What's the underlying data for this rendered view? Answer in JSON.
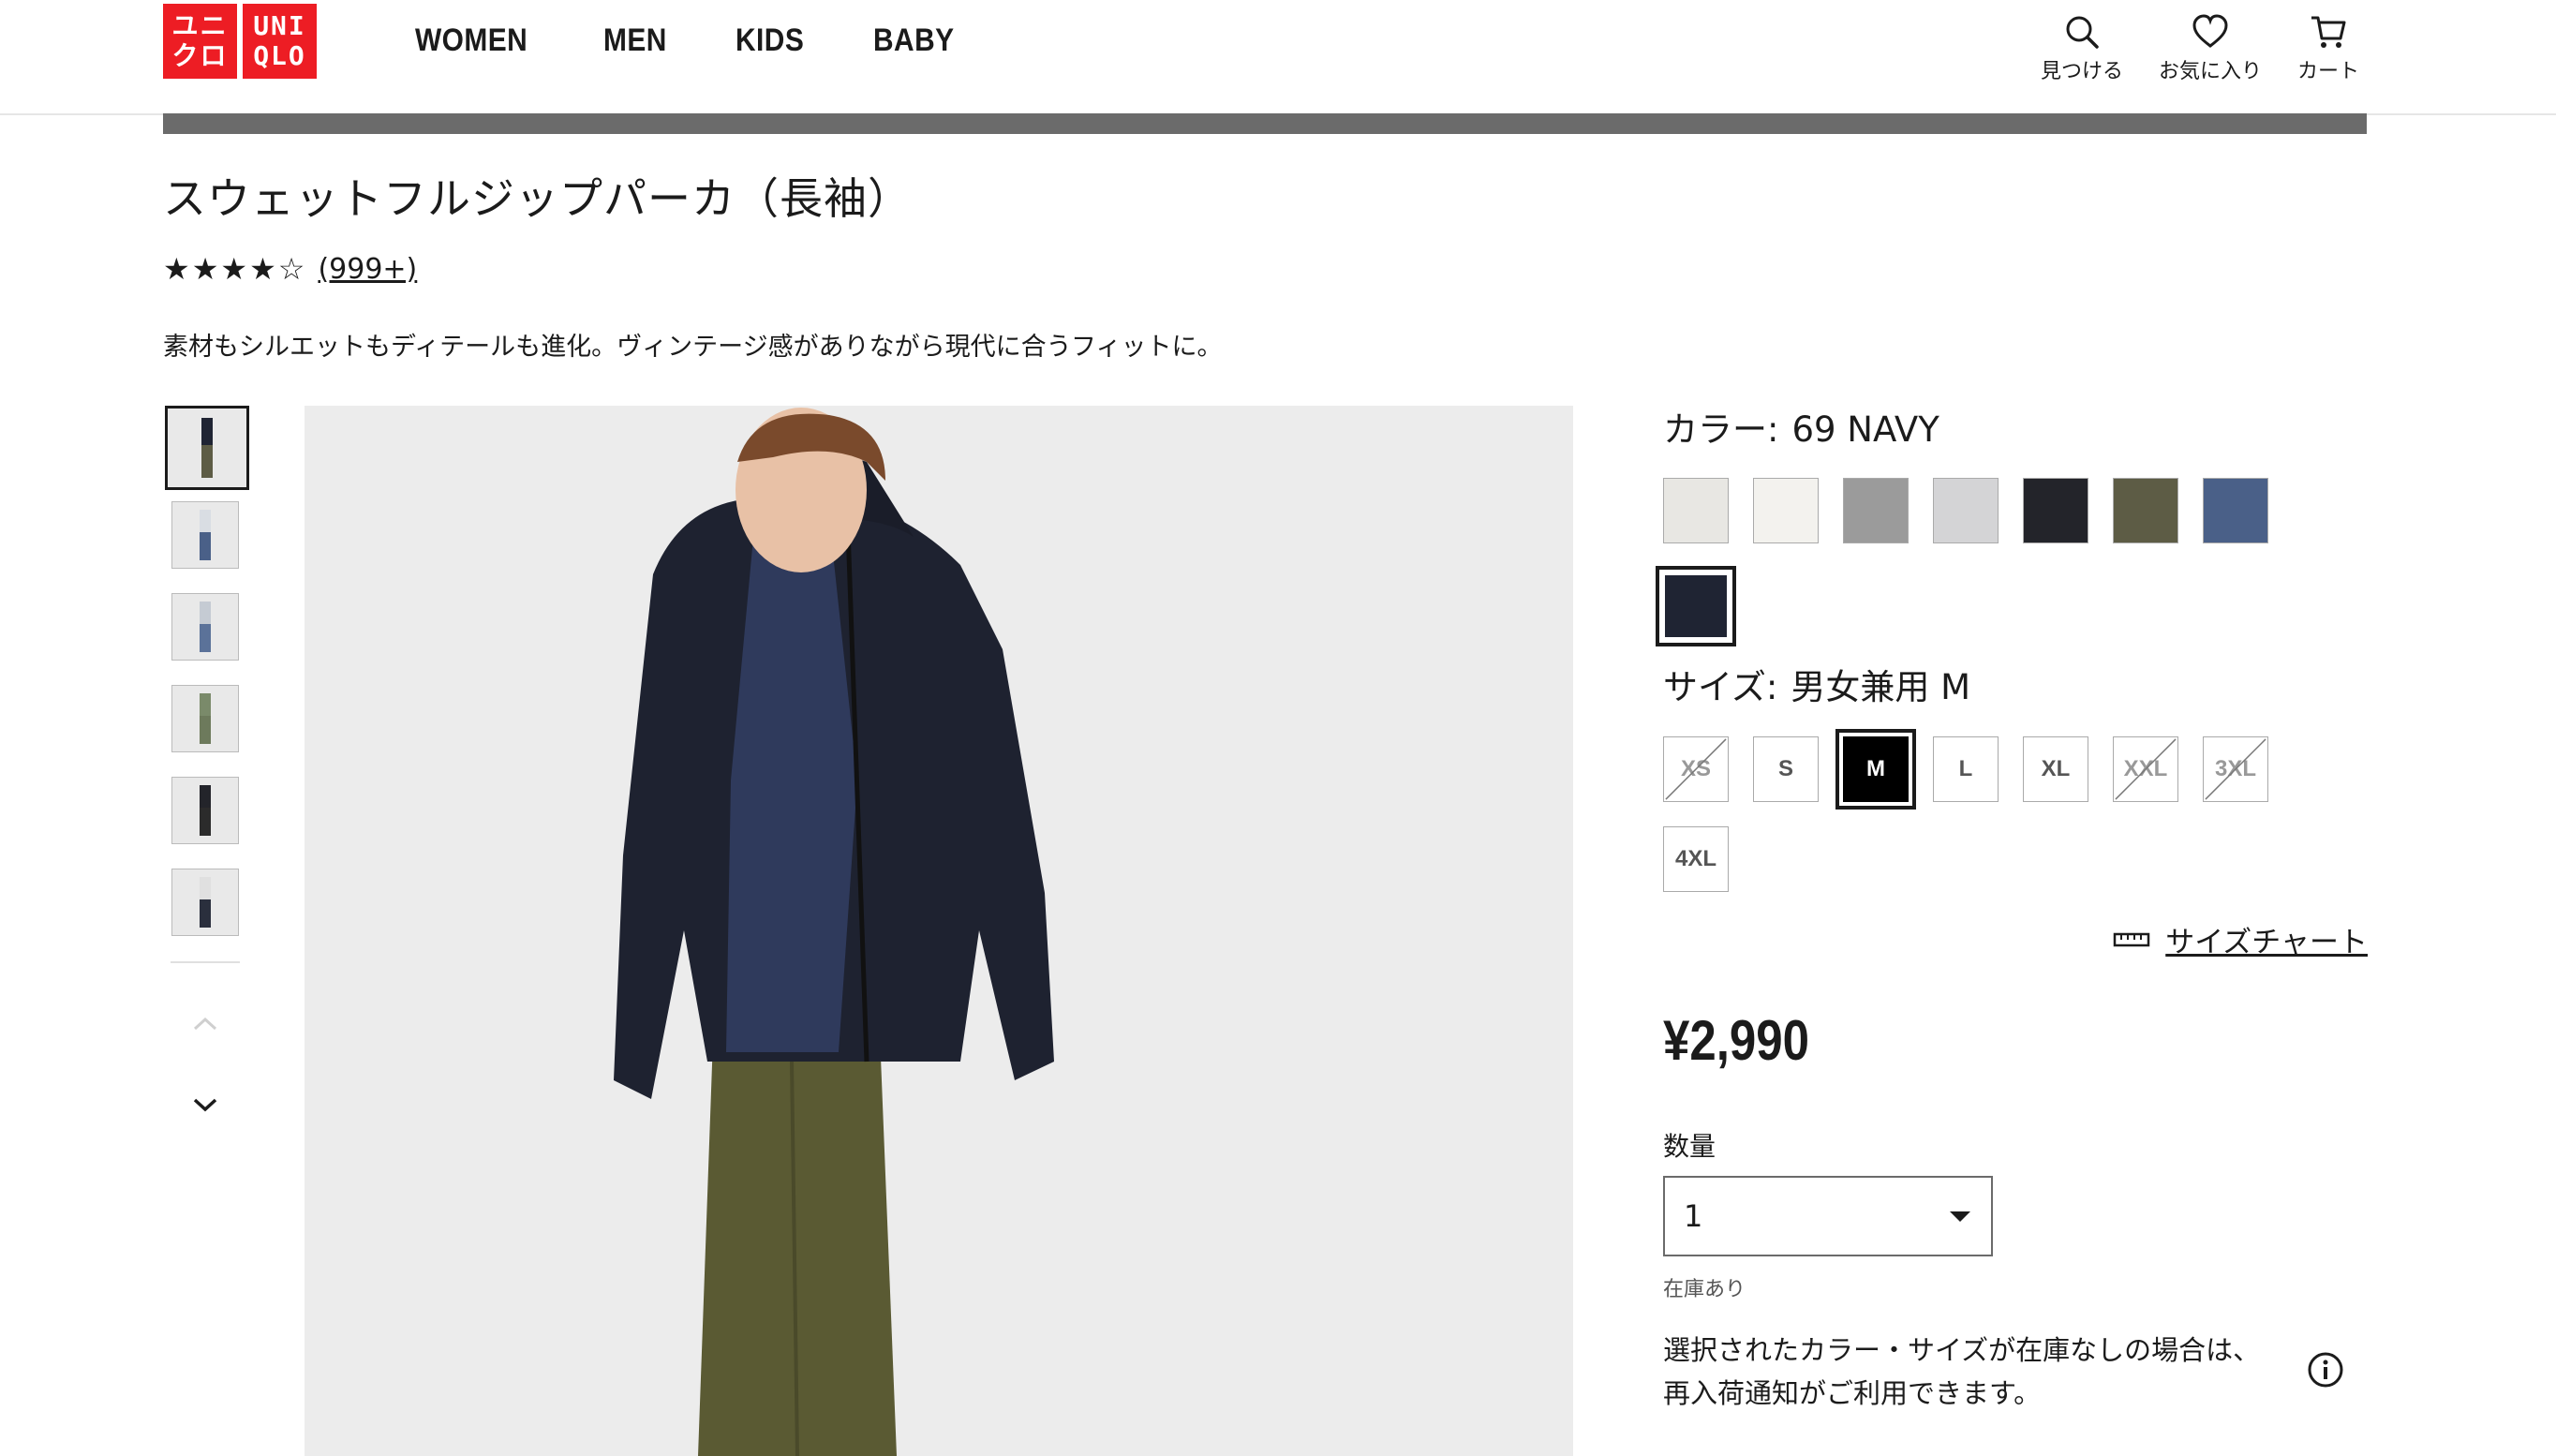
{
  "brand": {
    "logo_top": "ユニ",
    "logo_bottom": "クロ",
    "logo_en_top": "UNI",
    "logo_en_bottom": "QLO"
  },
  "nav": {
    "women": "WOMEN",
    "men": "MEN",
    "kids": "KIDS",
    "baby": "BABY"
  },
  "header_tools": {
    "search": "見つける",
    "favorites": "お気に入り",
    "cart": "カート"
  },
  "product": {
    "title": "スウェットフルジップパーカ（長袖）",
    "stars": "★★★★☆",
    "rating": 4.5,
    "review_count": "(999+)",
    "description": "素材もシルエットもディテールも進化。ヴィンテージ感がありながら現代に合うフィットに。"
  },
  "color": {
    "label": "カラー:",
    "value": "69 NAVY",
    "swatches": [
      "#e8e7e3",
      "#f3f2ee",
      "#9b9b9b",
      "#d4d4d6",
      "#23242a",
      "#5d5c45",
      "#4a6088",
      "#1f2433"
    ],
    "selected_index": 7
  },
  "size": {
    "label": "サイズ:",
    "value": "男女兼用 M",
    "options": [
      "XS",
      "S",
      "M",
      "L",
      "XL",
      "XXL",
      "3XL",
      "4XL"
    ],
    "selected": "M",
    "unavailable": [
      "XS",
      "XXL",
      "3XL"
    ],
    "chart_link": "サイズチャート"
  },
  "price": "¥2,990",
  "quantity": {
    "label": "数量",
    "value": "1"
  },
  "stock_status": "在庫あり",
  "restock_notice_line1": "選択されたカラー・サイズが在庫なしの場合は、",
  "restock_notice_line2": "再入荷通知がご利用できます。",
  "colors": {
    "brand_red": "#ed1d24",
    "text": "#1b1b1b",
    "banner": "#6b6b6b"
  }
}
